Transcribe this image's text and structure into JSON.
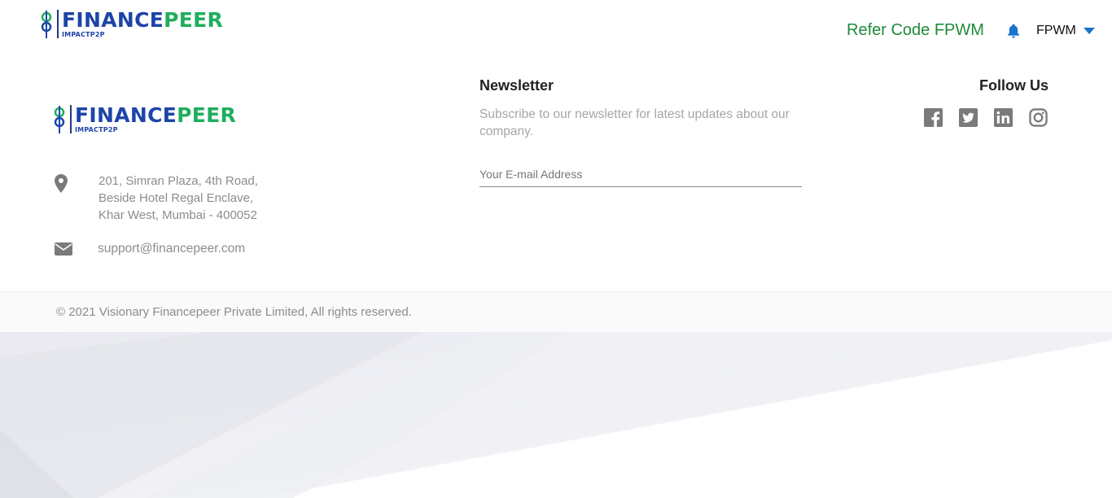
{
  "header": {
    "brand": {
      "name_part1": "FINANCE",
      "name_part2": "PEER",
      "tagline": "IMPACTP2P"
    },
    "refer_code": "Refer Code FPWM",
    "user_name": "FPWM",
    "icons": {
      "notifications": "bell-icon",
      "user_menu": "caret-down-icon"
    }
  },
  "footer": {
    "brand": {
      "name_part1": "FINANCE",
      "name_part2": "PEER",
      "tagline": "IMPACTP2P"
    },
    "address": {
      "icon": "map-pin-icon",
      "line1": "201, Simran Plaza, 4th Road,",
      "line2": "Beside Hotel Regal Enclave,",
      "line3": "Khar West, Mumbai - 400052"
    },
    "email": {
      "icon": "envelope-icon",
      "text": "support@financepeer.com"
    },
    "newsletter": {
      "title": "Newsletter",
      "description": "Subscribe to our newsletter for latest updates about our company.",
      "input_placeholder": "Your E-mail Address",
      "input_value": ""
    },
    "follow": {
      "title": "Follow Us",
      "networks": [
        "facebook-icon",
        "twitter-icon",
        "linkedin-icon",
        "instagram-icon"
      ]
    },
    "copyright": "© 2021 Visionary Financepeer Private Limited, All rights reserved."
  },
  "colors": {
    "brand_blue": "#1d45a8",
    "brand_green": "#1fae5e",
    "refer_green": "#1f8a3a",
    "accent_blue": "#1a73c8",
    "icon_gray": "#7a7a7a"
  }
}
